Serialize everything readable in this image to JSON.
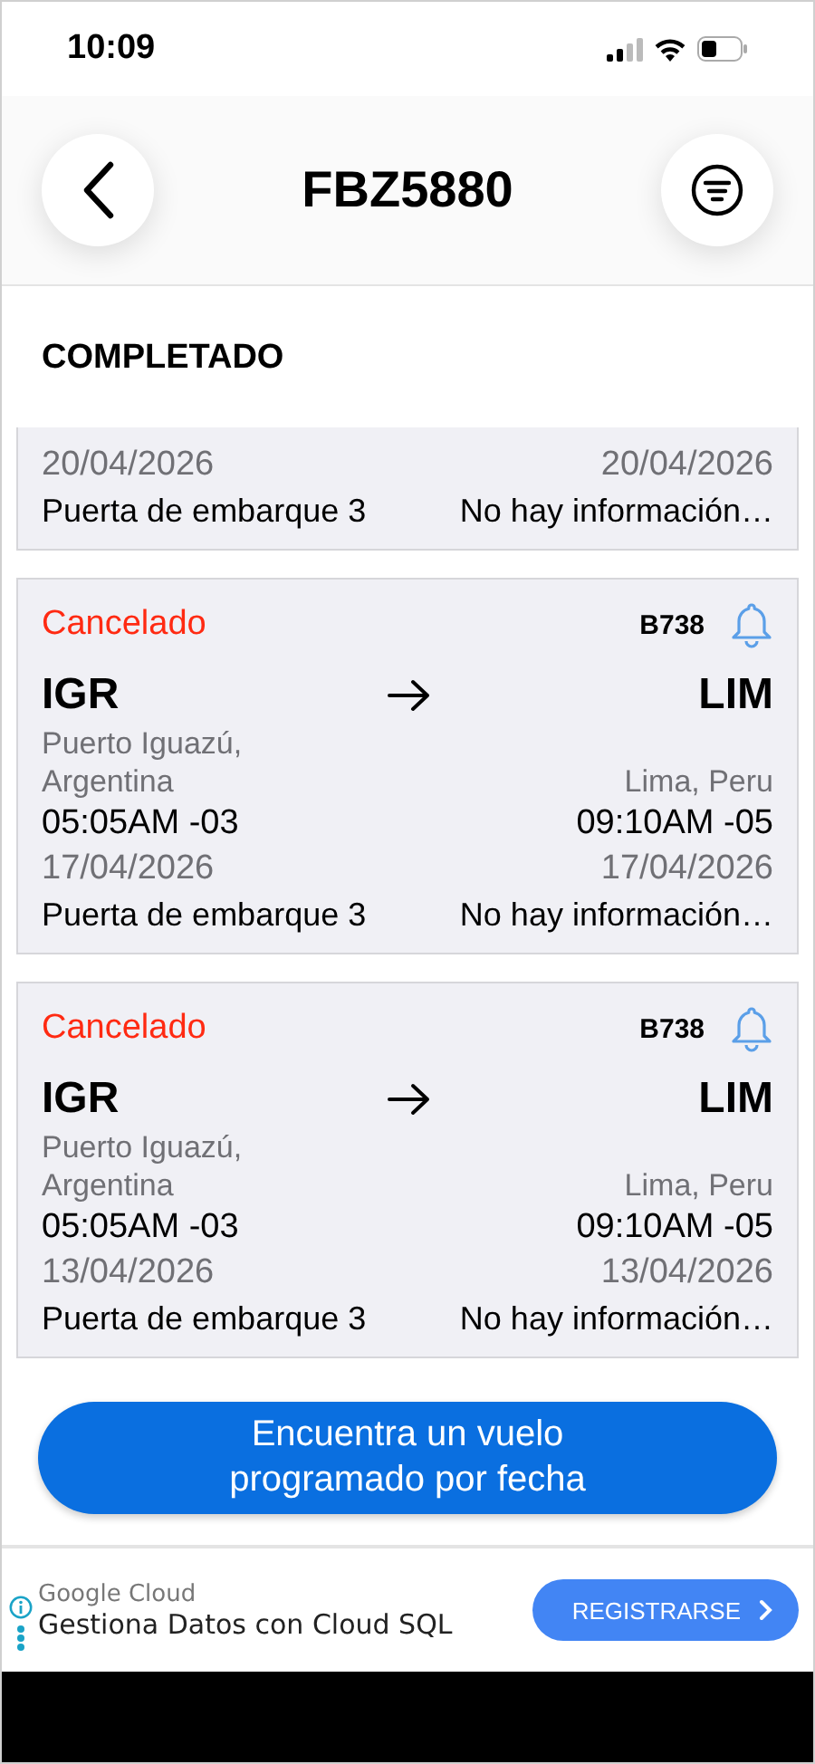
{
  "status_bar": {
    "time": "10:09"
  },
  "header": {
    "title": "FBZ5880"
  },
  "section": {
    "title": "COMPLETADO"
  },
  "partial_flight": {
    "dep_date": "20/04/2026",
    "arr_date": "20/04/2026",
    "gate": "Puerta de embarque 3",
    "info": "No hay información…"
  },
  "flights": [
    {
      "status": "Cancelado",
      "color": "#ff2a12",
      "aircraft": "B738",
      "origin": {
        "code": "IGR",
        "city": "Puerto Iguazú, Argentina"
      },
      "destination": {
        "code": "LIM",
        "city": "Lima, Peru"
      },
      "dep_time": "05:05AM -03",
      "dep_date": "17/04/2026",
      "arr_time": "09:10AM -05",
      "arr_date": "17/04/2026",
      "gate": "Puerta de embarque 3",
      "info": "No hay información…"
    },
    {
      "status": "Cancelado",
      "color": "#ff2a12",
      "aircraft": "B738",
      "origin": {
        "code": "IGR",
        "city": "Puerto Iguazú, Argentina"
      },
      "destination": {
        "code": "LIM",
        "city": "Lima, Peru"
      },
      "dep_time": "05:05AM -03",
      "dep_date": "13/04/2026",
      "arr_time": "09:10AM -05",
      "arr_date": "13/04/2026",
      "gate": "Puerta de embarque 3",
      "info": "No hay información…"
    }
  ],
  "find_button": {
    "label": "Encuentra un vuelo programado por fecha"
  },
  "ad": {
    "sponsor": "Google Cloud",
    "headline": "Gestiona Datos con Cloud SQL",
    "button": "REGISTRARSE"
  }
}
